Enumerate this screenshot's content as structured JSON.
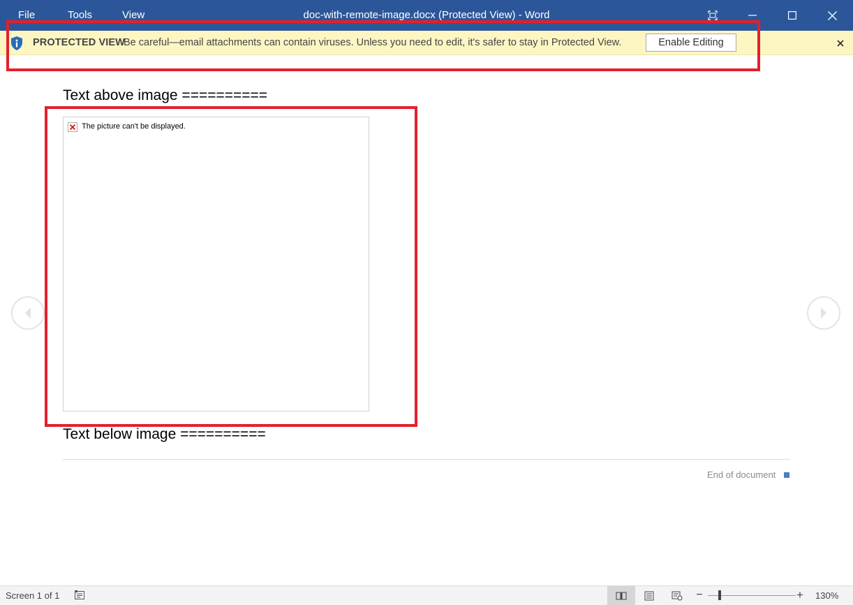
{
  "titlebar": {
    "menus": [
      "File",
      "Tools",
      "View"
    ],
    "title": "doc-with-remote-image.docx (Protected View) - Word",
    "background": "#2b579a"
  },
  "protected_view": {
    "heading": "PROTECTED VIEW",
    "message": "Be careful—email attachments can contain viruses. Unless you need to edit, it's safer to stay in Protected View.",
    "button_label": "Enable Editing",
    "icon": "shield-info-icon",
    "background": "#fdf6c3"
  },
  "document": {
    "text_above": "Text above image ==========",
    "image_placeholder": "The picture can't be displayed.",
    "text_below": "Text below image ==========",
    "end_label": "End of document"
  },
  "statusbar": {
    "screen_count": "Screen 1 of 1",
    "zoom_label": "130%"
  },
  "highlight_color": "#e3202b"
}
